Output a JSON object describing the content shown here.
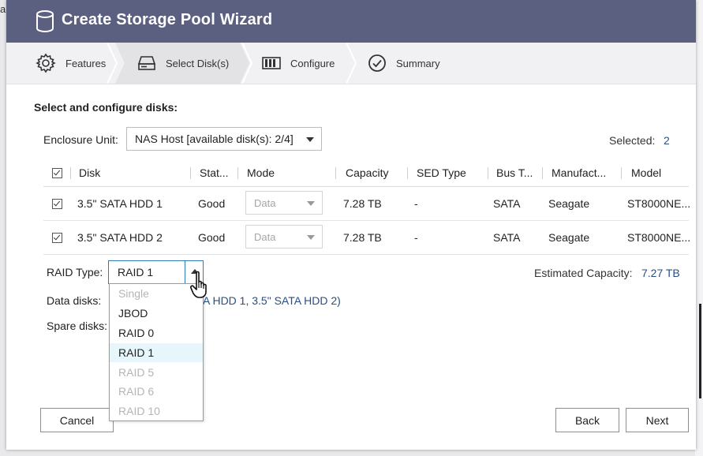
{
  "window": {
    "title": "Create Storage Pool Wizard",
    "edge_text": "ai"
  },
  "steps": [
    {
      "label": "Features",
      "icon": "gear-icon"
    },
    {
      "label": "Select Disk(s)",
      "icon": "disk-drive-icon",
      "active": true
    },
    {
      "label": "Configure",
      "icon": "raid-configure-icon"
    },
    {
      "label": "Summary",
      "icon": "check-circle-icon"
    }
  ],
  "main": {
    "section_title": "Select and configure disks:",
    "enclosure_label": "Enclosure Unit:",
    "enclosure_value": "NAS Host [available disk(s): 2/4]",
    "selected_label": "Selected:",
    "selected_count": "2"
  },
  "table": {
    "columns": [
      "Disk",
      "Stat...",
      "Mode",
      "Capacity",
      "SED Type",
      "Bus T...",
      "Manufact...",
      "Model"
    ],
    "rows": [
      {
        "disk": "3.5\" SATA HDD 1",
        "status": "Good",
        "mode": "Data",
        "capacity": "7.28 TB",
        "sed": "-",
        "bus": "SATA",
        "manufacturer": "Seagate",
        "model": "ST8000NE..."
      },
      {
        "disk": "3.5\" SATA HDD 2",
        "status": "Good",
        "mode": "Data",
        "capacity": "7.28 TB",
        "sed": "-",
        "bus": "SATA",
        "manufacturer": "Seagate",
        "model": "ST8000NE..."
      }
    ]
  },
  "raid": {
    "label": "RAID Type:",
    "value": "RAID 1",
    "options": [
      {
        "label": "Single",
        "disabled": true
      },
      {
        "label": "JBOD",
        "disabled": false
      },
      {
        "label": "RAID 0",
        "disabled": false
      },
      {
        "label": "RAID 1",
        "disabled": false,
        "active": true
      },
      {
        "label": "RAID 5",
        "disabled": true
      },
      {
        "label": "RAID 6",
        "disabled": true
      },
      {
        "label": "RAID 10",
        "disabled": true
      }
    ],
    "estimated_label": "Estimated Capacity:",
    "estimated_value": "7.27 TB",
    "data_disks_label": "Data disks:",
    "data_disks_value": "A HDD 1, 3.5\" SATA HDD 2)",
    "spare_disks_label": "Spare disks:"
  },
  "footer": {
    "cancel_label": "Cancel",
    "back_label": "Back",
    "next_label": "Next"
  },
  "colors": {
    "titlebar": "#5b6080",
    "link_value": "#2a4e86",
    "focus_border": "#2f7ab8",
    "highlight_option": "#e6f6fb"
  }
}
